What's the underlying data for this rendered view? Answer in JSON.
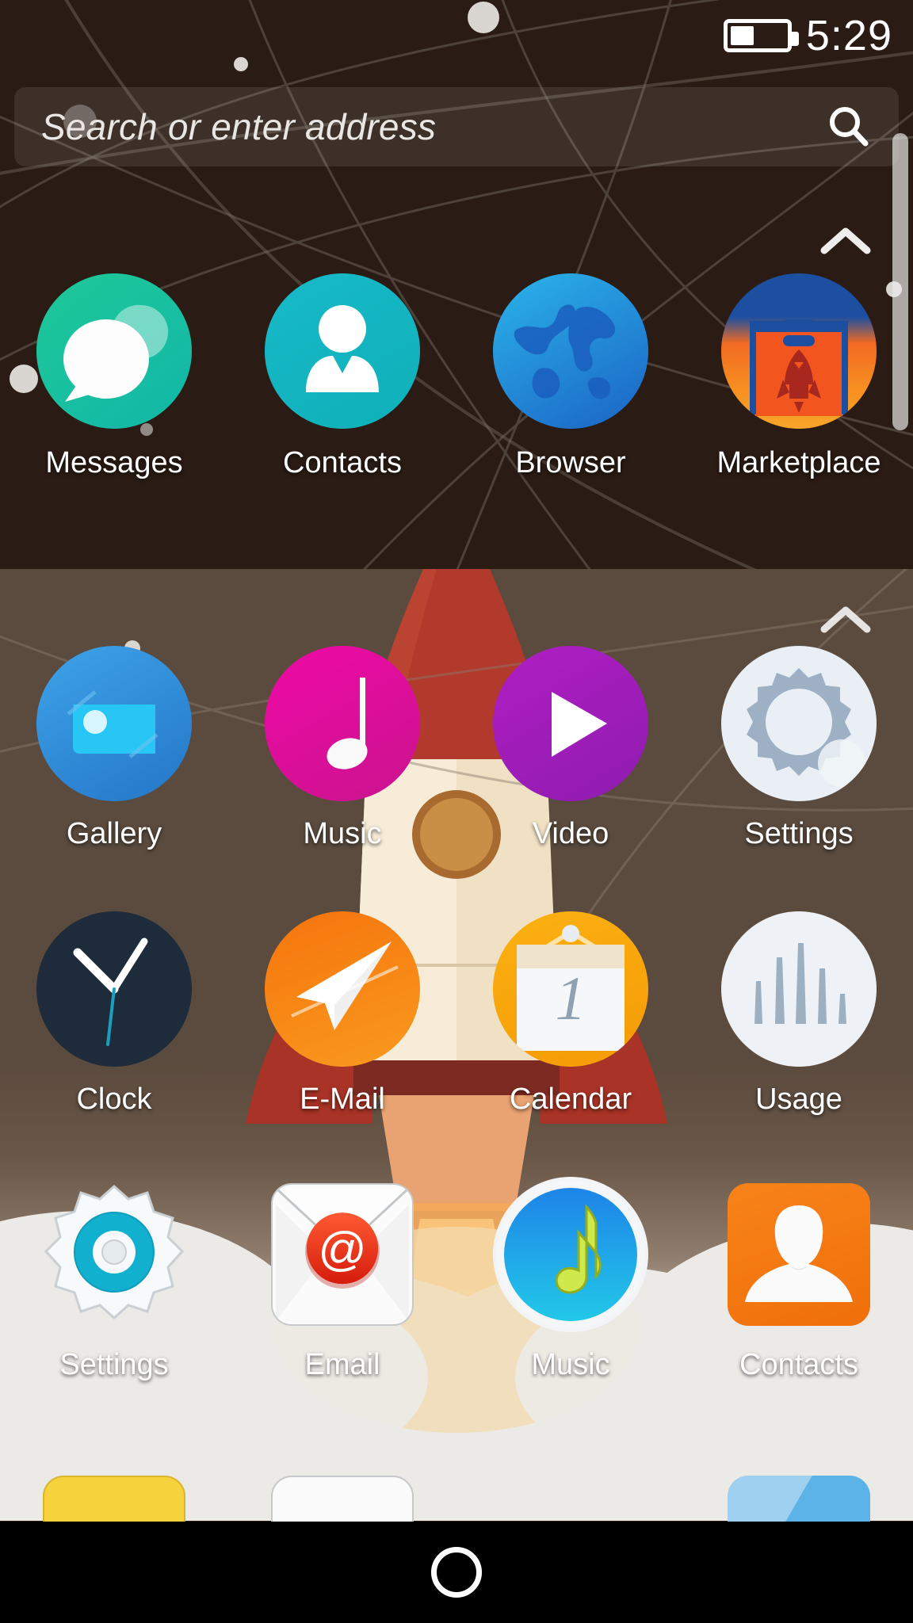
{
  "status_bar": {
    "time": "5:29",
    "battery_icon": "battery-icon",
    "battery_level_percent": 38
  },
  "search": {
    "placeholder": "Search or enter address",
    "icon": "search-icon"
  },
  "colors": {
    "wallpaper_dark": "#2a1c14",
    "wallpaper_light": "#5b4b3e",
    "navbar": "#000000",
    "label_text": "#ffffff",
    "scrollbar": "#ebebeb"
  },
  "sections": [
    {
      "name": "top-section",
      "collapse_icon": "chevron-up-icon",
      "apps": [
        {
          "label": "Messages",
          "icon": "messages-icon",
          "shape": "circle",
          "color": "#17c79a"
        },
        {
          "label": "Contacts",
          "icon": "contacts-icon",
          "shape": "circle",
          "color": "#14b8c4"
        },
        {
          "label": "Browser",
          "icon": "browser-globe-icon",
          "shape": "circle",
          "color": "#1b9fe0"
        },
        {
          "label": "Marketplace",
          "icon": "marketplace-icon",
          "shape": "circle",
          "color": "#f4801e"
        }
      ]
    },
    {
      "name": "bottom-section",
      "collapse_icon": "chevron-up-icon",
      "apps": [
        {
          "label": "Gallery",
          "icon": "gallery-icon",
          "shape": "circle",
          "color": "#2e9be0"
        },
        {
          "label": "Music",
          "icon": "music-note-icon",
          "shape": "circle",
          "color": "#e0139b"
        },
        {
          "label": "Video",
          "icon": "video-play-icon",
          "shape": "circle",
          "color": "#a022b8"
        },
        {
          "label": "Settings",
          "icon": "settings-gear-icon",
          "shape": "circle",
          "color": "#e8eef2"
        },
        {
          "label": "Clock",
          "icon": "clock-icon",
          "shape": "circle",
          "color": "#1d2b3a"
        },
        {
          "label": "E-Mail",
          "icon": "email-plane-icon",
          "shape": "circle",
          "color": "#f57c12"
        },
        {
          "label": "Calendar",
          "icon": "calendar-icon",
          "shape": "circle",
          "color": "#f9a30c"
        },
        {
          "label": "Usage",
          "icon": "usage-bars-icon",
          "shape": "circle",
          "color": "#eef2f6"
        },
        {
          "label": "Settings",
          "icon": "settings-ring-icon",
          "shape": "gear",
          "color": "#00b4d2"
        },
        {
          "label": "Email",
          "icon": "email-envelope-icon",
          "shape": "rounded-sq",
          "color": "#ed2f1f"
        },
        {
          "label": "Music",
          "icon": "music-circle-icon",
          "shape": "circle",
          "color": "#1eb9e8"
        },
        {
          "label": "Contacts",
          "icon": "contacts-person-icon",
          "shape": "rounded-sq",
          "color": "#f47b13"
        }
      ]
    }
  ],
  "partial_row": [
    {
      "icon": "partial-icon-yellow",
      "color": "#f7d33f"
    },
    {
      "icon": "partial-icon-white",
      "color": "#fafafa"
    },
    {
      "icon": "partial-icon-empty",
      "color": "transparent"
    },
    {
      "icon": "partial-icon-blue",
      "color": "#86c5ea"
    }
  ],
  "navbar": {
    "home_button": "home-button-icon"
  }
}
